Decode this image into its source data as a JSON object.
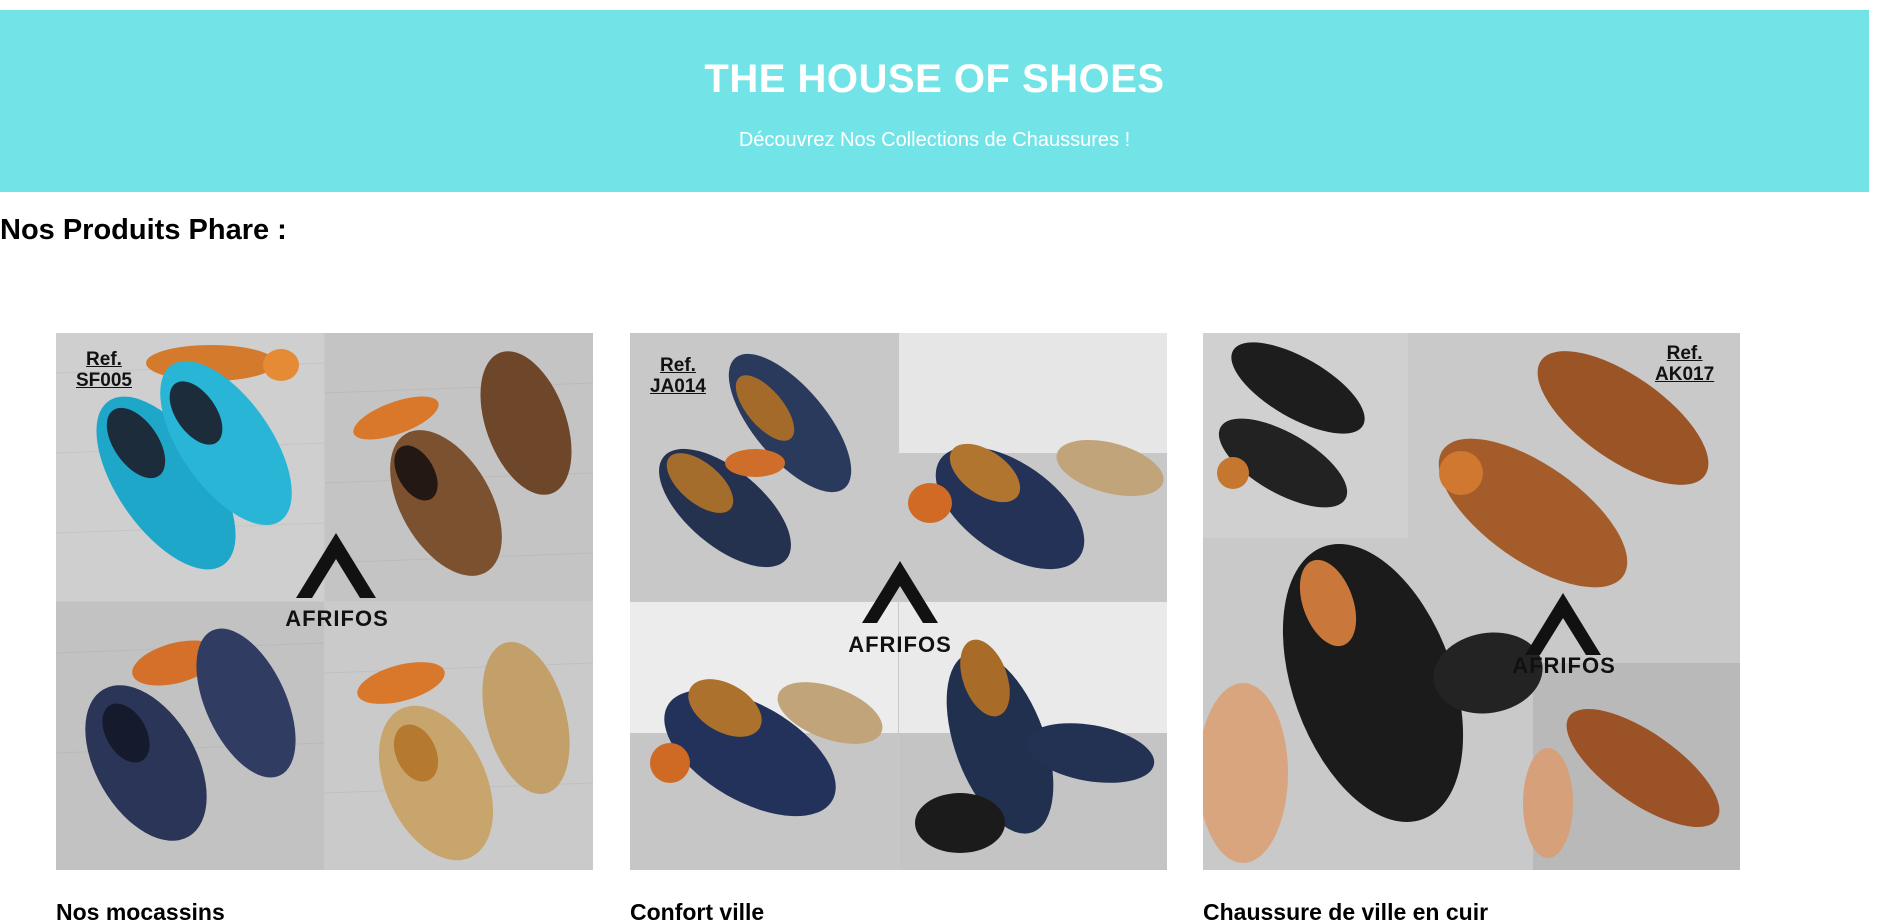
{
  "banner": {
    "title": "THE HOUSE OF SHOES",
    "subtitle": "Découvrez Nos Collections de Chaussures !",
    "background_color": "#72e4e8"
  },
  "section": {
    "title": "Nos Produits Phare :"
  },
  "products": [
    {
      "name": "Nos mocassins",
      "ref_word": "Ref.",
      "ref_code": "SF005",
      "logo_text": "AFRIFOS"
    },
    {
      "name": "Confort ville",
      "ref_word": "Ref.",
      "ref_code": "JA014",
      "logo_text": "AFRIFOS"
    },
    {
      "name": "Chaussure de ville en cuir",
      "ref_word": "Ref.",
      "ref_code": "AK017",
      "logo_text": "AFRIFOS"
    }
  ]
}
